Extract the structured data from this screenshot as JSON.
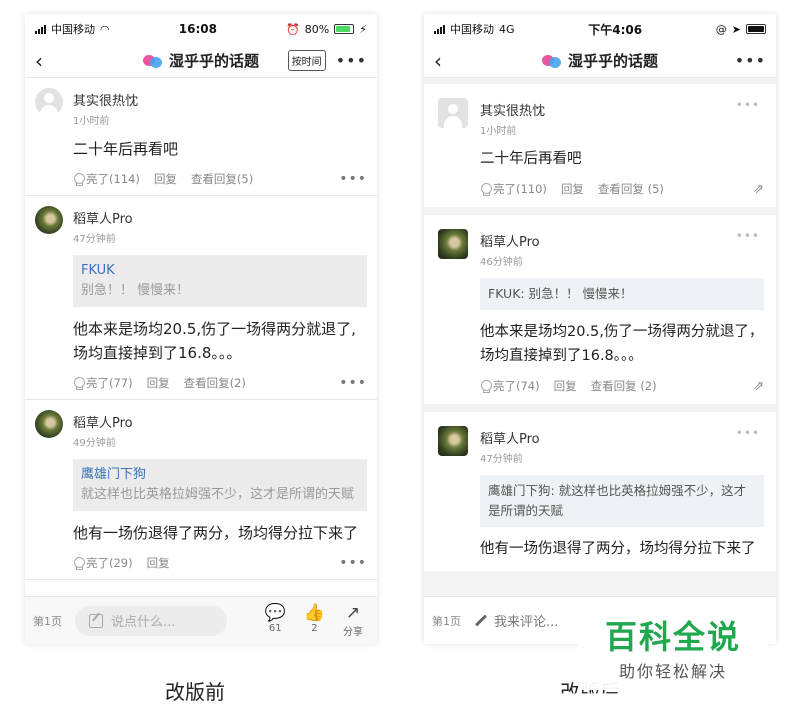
{
  "old": {
    "status": {
      "carrier": "中国移动",
      "time": "16:08",
      "battery": "80%",
      "battery_level": 0.8
    },
    "nav": {
      "title": "湿乎乎的话题",
      "sort_button": "按时间",
      "more": "•••"
    },
    "comments": [
      {
        "user": "其实很热忱",
        "time": "1小时前",
        "quote_name": "",
        "quote_text": "",
        "text": "二十年后再看吧",
        "likes": "亮了(114)",
        "reply": "回复",
        "view_replies": "查看回复(5)"
      },
      {
        "user": "稻草人Pro",
        "time": "47分钟前",
        "quote_name": "FKUK",
        "quote_text": "别急！！ 慢慢来！",
        "text": "他本来是场均20.5,伤了一场得两分就退了,场均直接掉到了16.8。。。",
        "likes": "亮了(77)",
        "reply": "回复",
        "view_replies": "查看回复(2)"
      },
      {
        "user": "稻草人Pro",
        "time": "49分钟前",
        "quote_name": "鹰雄门下狗",
        "quote_text": "就这样也比英格拉姆强不少，这才是所谓的天赋",
        "text": "他有一场伤退得了两分，场均得分拉下来了",
        "likes": "亮了(29)",
        "reply": "回复",
        "view_replies": ""
      }
    ],
    "bottom": {
      "page": "第1页",
      "input_placeholder": "说点什么...",
      "comments_count": "61",
      "likes_count": "2",
      "share": "分享"
    },
    "caption": "改版前"
  },
  "new": {
    "status": {
      "carrier": "中国移动",
      "network": "4G",
      "time": "下午4:06"
    },
    "nav": {
      "title": "湿乎乎的话题",
      "more": "•••"
    },
    "comments": [
      {
        "user": "其实很热忱",
        "time": "1小时前",
        "quote": "",
        "text": "二十年后再看吧",
        "likes": "亮了(110)",
        "reply": "回复",
        "view_replies": "查看回复 (5)"
      },
      {
        "user": "稻草人Pro",
        "time": "46分钟前",
        "quote": "FKUK: 别急！！ 慢慢来！",
        "text": "他本来是场均20.5,伤了一场得两分就退了，场均直接掉到了16.8。。。",
        "likes": "亮了(74)",
        "reply": "回复",
        "view_replies": "查看回复 (2)"
      },
      {
        "user": "稻草人Pro",
        "time": "47分钟前",
        "quote": "鹰雄门下狗: 就这样也比英格拉姆强不少，这才是所谓的天赋",
        "text": "他有一场伤退得了两分，场均得分拉下来了",
        "likes": "",
        "reply": "",
        "view_replies": ""
      }
    ],
    "bottom": {
      "page": "第1页",
      "input_placeholder": "我来评论..."
    },
    "caption": "改版后"
  },
  "watermark": {
    "main": "百科全说",
    "sub": "助你轻松解决"
  },
  "colors": {
    "link_blue": "#3a73b8",
    "watermark_green": "#1fa84e",
    "battery_green": "#4cd964"
  },
  "icons": [
    "wifi-icon",
    "alarm-icon",
    "location-icon",
    "comment-bubble-icon",
    "thumbs-up-icon",
    "share-icon",
    "lightbulb-icon"
  ]
}
